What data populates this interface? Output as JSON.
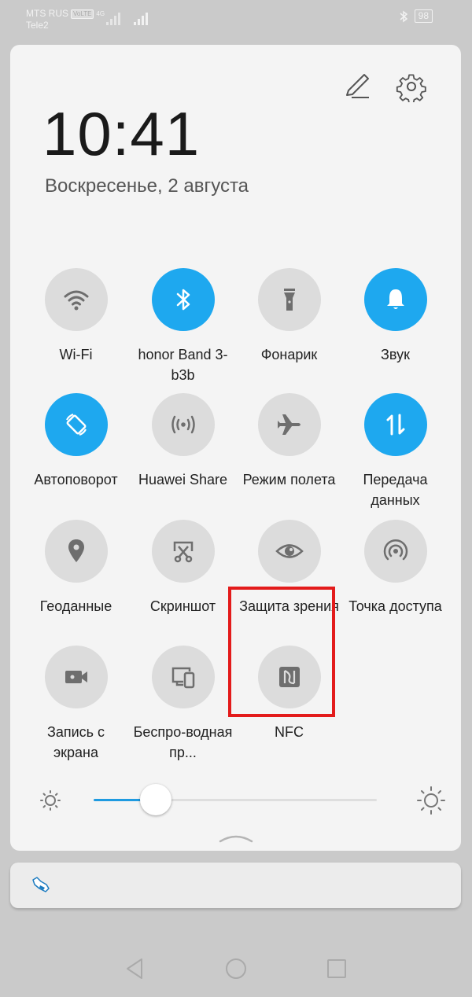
{
  "status_bar": {
    "carrier_1": "MTS RUS",
    "volte_badge": "VoLTE",
    "network_type": "4G",
    "carrier_2": "Tele2",
    "battery_level": "98",
    "bluetooth_icon": "bluetooth-icon"
  },
  "header": {
    "time": "10:41",
    "date": "Воскресенье, 2 августа",
    "edit_icon": "pencil-icon",
    "settings_icon": "gear-icon"
  },
  "tiles": [
    {
      "label": "Wi-Fi",
      "icon": "wifi-icon",
      "active": false
    },
    {
      "label": "honor Band 3-b3b",
      "icon": "bluetooth-icon",
      "active": true
    },
    {
      "label": "Фонарик",
      "icon": "flashlight-icon",
      "active": false
    },
    {
      "label": "Звук",
      "icon": "bell-icon",
      "active": true
    },
    {
      "label": "Автоповорот",
      "icon": "rotate-icon",
      "active": true
    },
    {
      "label": "Huawei Share",
      "icon": "share-waves-icon",
      "active": false
    },
    {
      "label": "Режим полета",
      "icon": "airplane-icon",
      "active": false
    },
    {
      "label": "Передача данных",
      "icon": "data-arrows-icon",
      "active": true
    },
    {
      "label": "Геоданные",
      "icon": "location-pin-icon",
      "active": false
    },
    {
      "label": "Скриншот",
      "icon": "screenshot-scissors-icon",
      "active": false
    },
    {
      "label": "Защита зрения",
      "icon": "eye-icon",
      "active": false
    },
    {
      "label": "Точка доступа",
      "icon": "hotspot-icon",
      "active": false
    },
    {
      "label": "Запись с экрана",
      "icon": "video-camera-icon",
      "active": false
    },
    {
      "label": "Беспро-водная пр...",
      "icon": "wireless-projection-icon",
      "active": false
    },
    {
      "label": "NFC",
      "icon": "nfc-icon",
      "active": false
    }
  ],
  "brightness": {
    "level_fraction": 0.22
  },
  "highlight": {
    "target": "NFC",
    "color": "#e31b1b"
  },
  "colors": {
    "accent": "#1ea8ef",
    "tile_off": "#dcdcdc",
    "panel_bg": "#f4f4f4"
  }
}
